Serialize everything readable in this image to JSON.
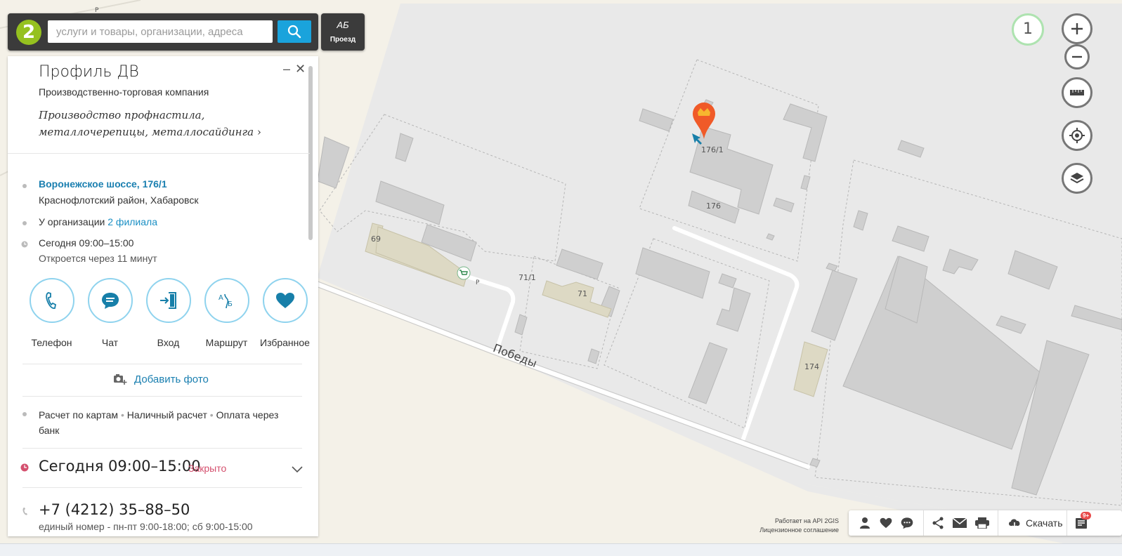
{
  "search": {
    "placeholder": "услуги и товары, организации, адреса",
    "logo": "2",
    "route_label": "Проезд",
    "route_glyph": "АБ"
  },
  "map": {
    "street": "Победы",
    "buildings": [
      "176/1",
      "176",
      "69",
      "71/1",
      "71",
      "174"
    ],
    "parking": [
      "Р",
      "Р"
    ],
    "zoom_level": "1"
  },
  "card": {
    "title": "Профиль ДВ",
    "subtitle": "Производственно-торговая компания",
    "tagline": "Производство профнастила, металлочерепицы, металлосайдинга",
    "address_link": "Воронежское шоссе, 176/1",
    "district": "Краснофлотский район, Хабаровск",
    "branches_prefix": "У организации",
    "branches_link": "2 филиала",
    "hours_today": "Сегодня 09:00–15:00",
    "opens_in": "Откроется через 11 минут",
    "actions": [
      {
        "label": "Телефон",
        "icon": "phone-icon"
      },
      {
        "label": "Чат",
        "icon": "chat-icon"
      },
      {
        "label": "Вход",
        "icon": "entrance-icon"
      },
      {
        "label": "Маршрут",
        "icon": "route-icon"
      },
      {
        "label": "Избранное",
        "icon": "heart-icon"
      }
    ],
    "add_photo": "Добавить фото",
    "payment": {
      "card": "Расчет по картам",
      "cash": "Наличный расчет",
      "bank": "Оплата через банк"
    },
    "hours_big": "Сегодня 09:00–15:00",
    "status": "Закрыто",
    "phone": "+7 (4212) 35–88–50",
    "phone_note": "единый номер - пн-пт 9:00-18:00; сб 9:00-15:00"
  },
  "footer": {
    "api_note": "Работает на API 2GIS",
    "license": "Лицензионное соглашение",
    "download": "Скачать",
    "badge": "9+"
  },
  "colors": {
    "accent": "#1aa3dc",
    "link": "#1a7fb0",
    "closed": "#d4506e",
    "marker": "#f05a28",
    "logo": "#95c11f"
  }
}
